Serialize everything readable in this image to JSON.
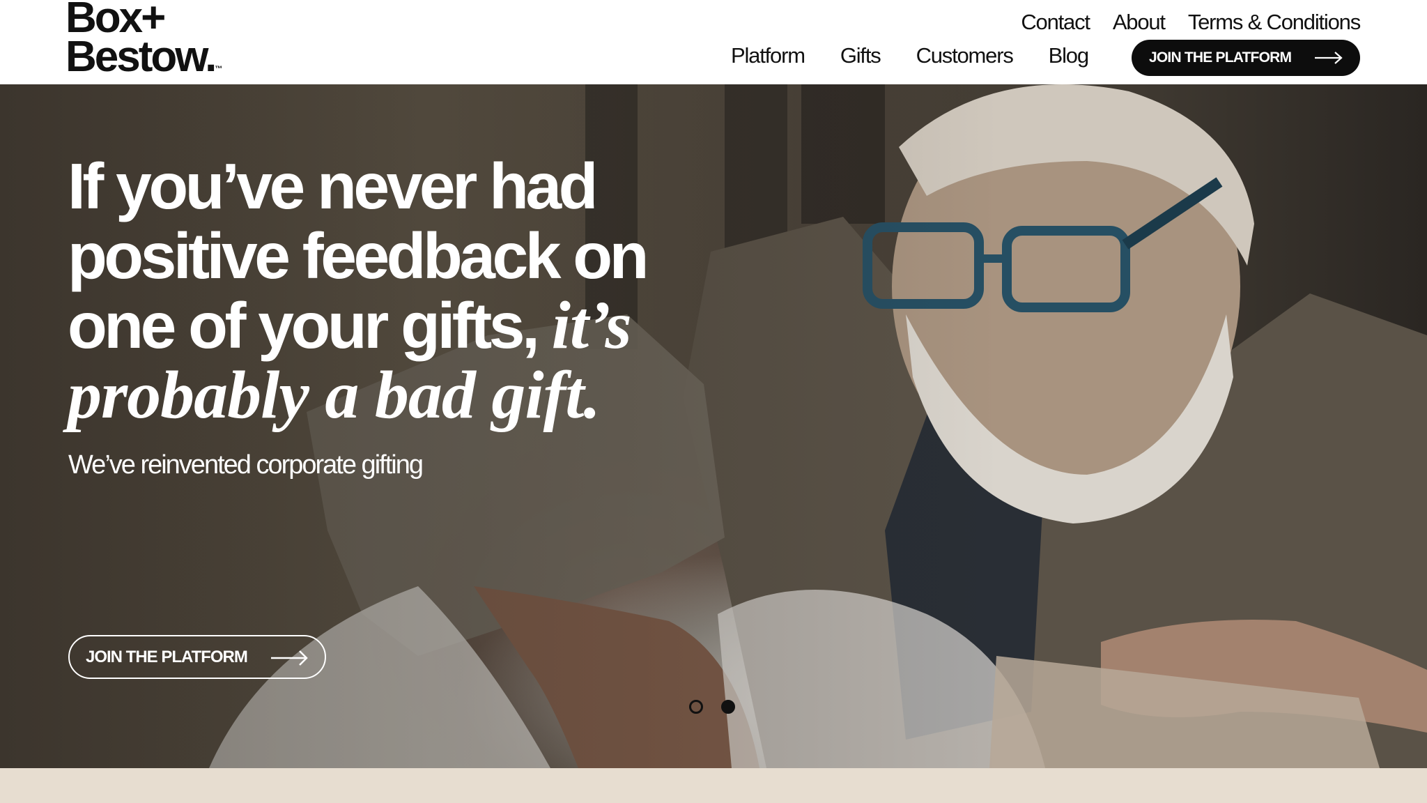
{
  "brand": {
    "logo_line1": "Box+",
    "logo_line2": "Bestow.",
    "logo_tm": "™"
  },
  "utility_nav": [
    {
      "label": "Contact"
    },
    {
      "label": "About"
    },
    {
      "label": "Terms & Conditions"
    }
  ],
  "main_nav": [
    {
      "label": "Platform"
    },
    {
      "label": "Gifts"
    },
    {
      "label": "Customers"
    },
    {
      "label": "Blog"
    }
  ],
  "header_cta": {
    "label": "JOIN THE PLATFORM",
    "icon": "arrow-right-icon"
  },
  "hero": {
    "headline_line1": "If you’ve never had",
    "headline_line2": "positive feedback on",
    "headline_line3": "one of your gifts,",
    "headline_emphasis_1": "it’s",
    "headline_emphasis_2": "probably a bad gift.",
    "subhead": "We’ve reinvented corporate gifting",
    "cta_label": "JOIN THE PLATFORM",
    "cta_icon": "arrow-right-icon",
    "carousel": {
      "slides": 2,
      "active": 2
    }
  },
  "colors": {
    "header_bg": "#ffffff",
    "cta_bg": "#0d0d0d",
    "band": "#e7ddd0",
    "hero_text": "#ffffff"
  }
}
